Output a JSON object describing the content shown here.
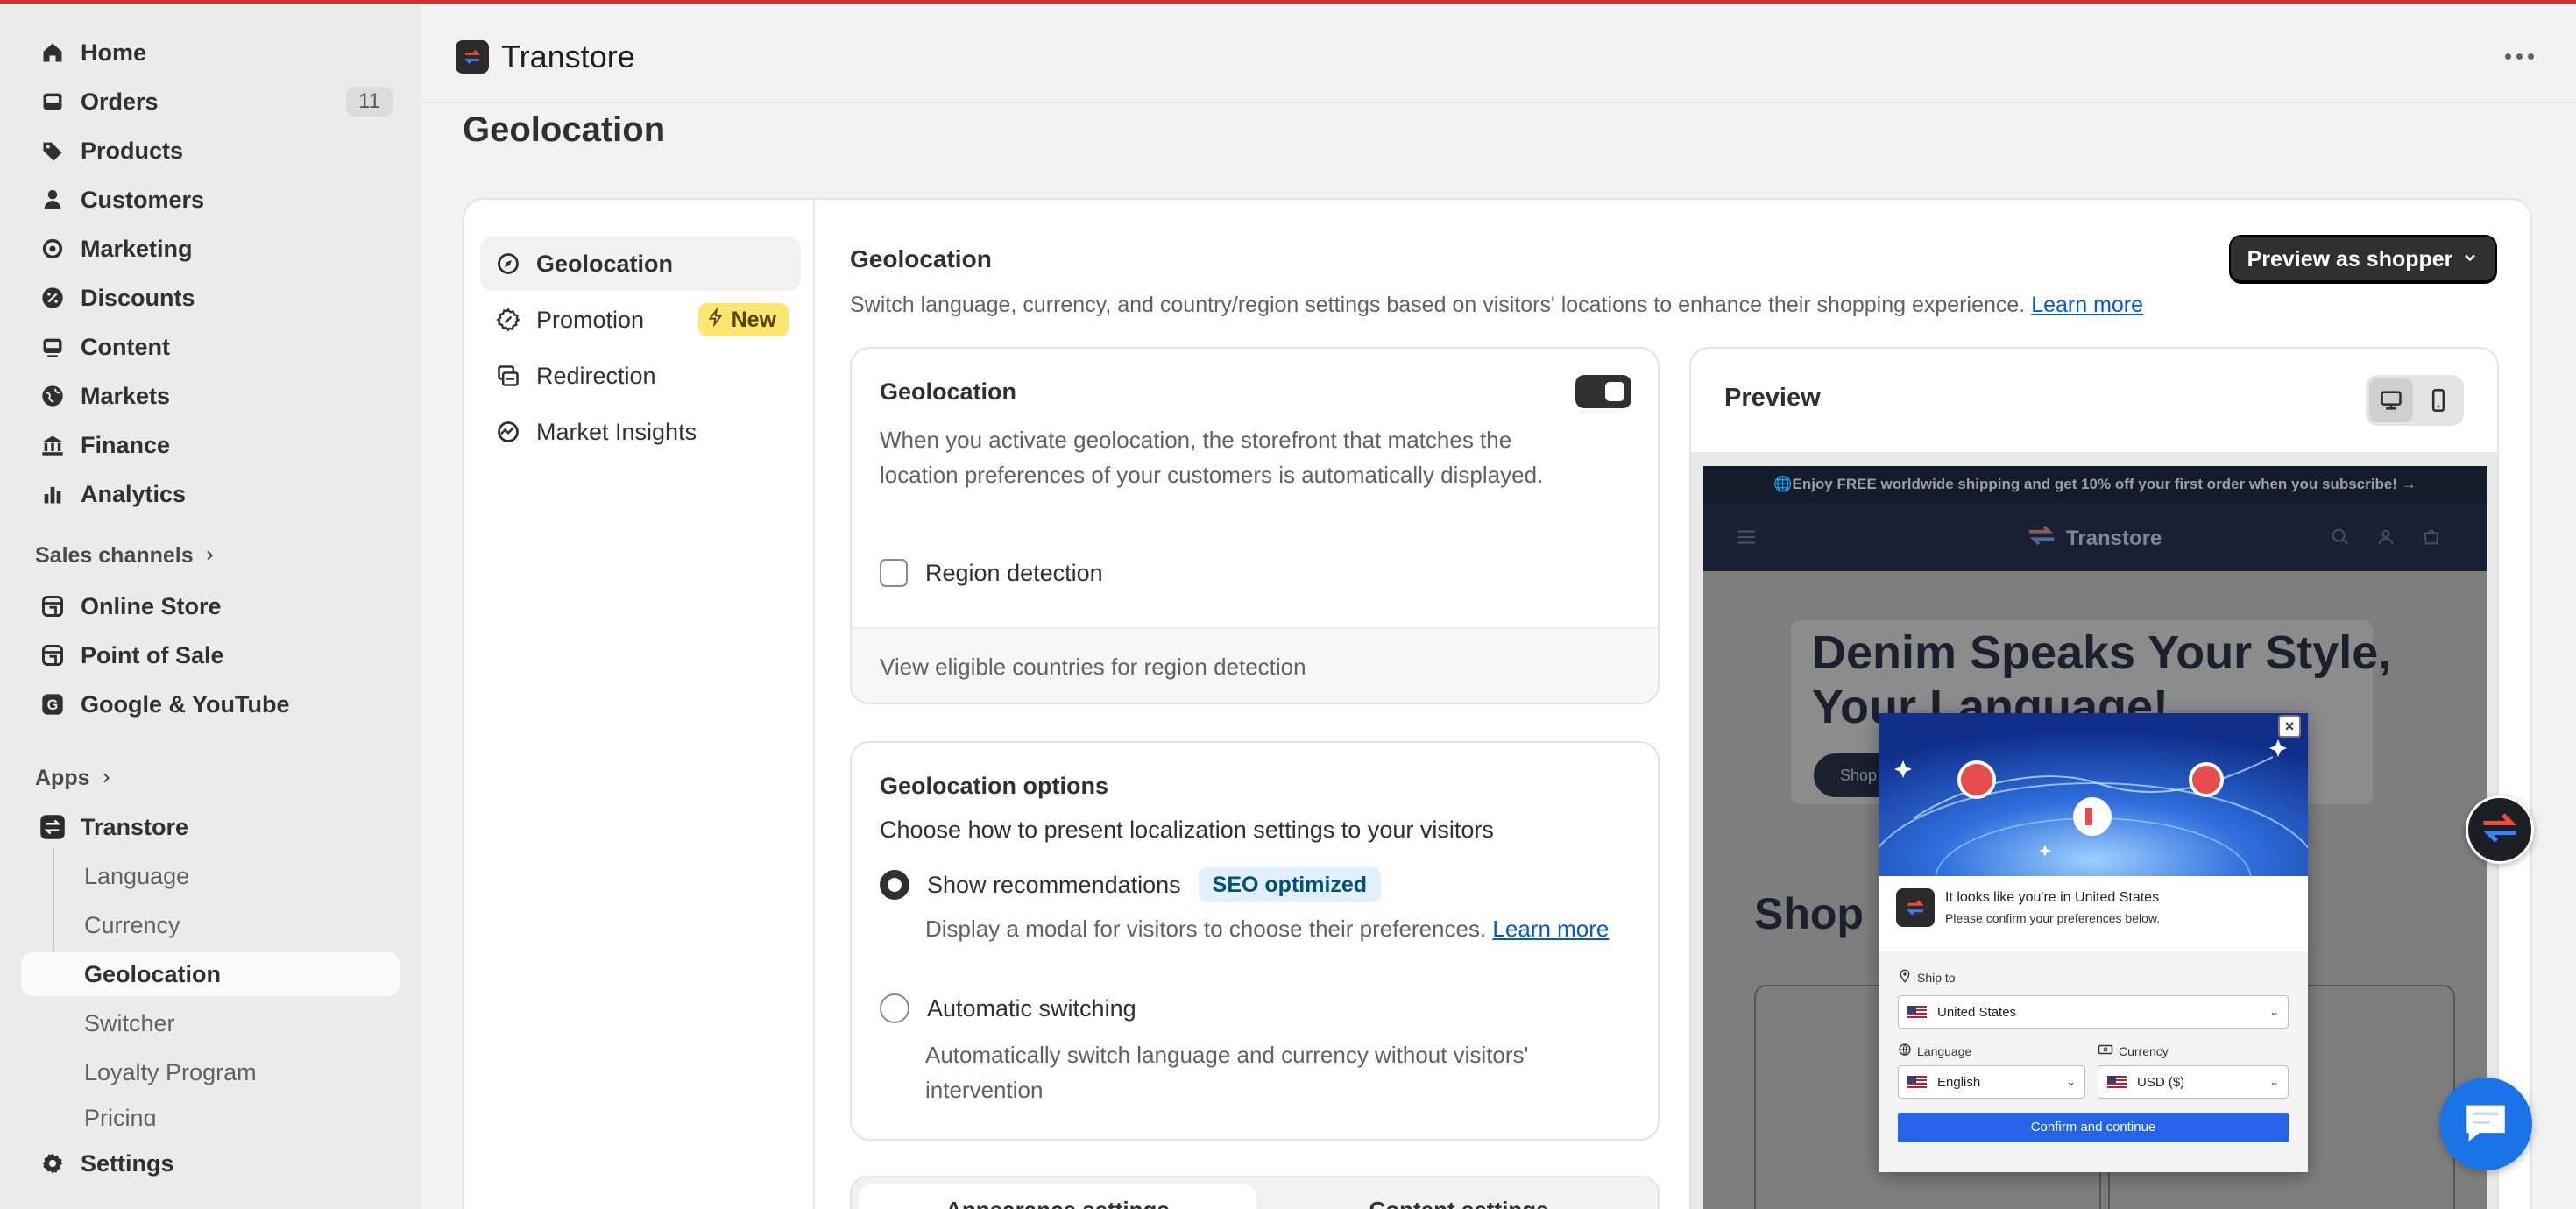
{
  "sidebar": {
    "items": [
      {
        "label": "Home",
        "icon": "home-icon"
      },
      {
        "label": "Orders",
        "icon": "orders-icon",
        "badge": "11"
      },
      {
        "label": "Products",
        "icon": "tag-icon"
      },
      {
        "label": "Customers",
        "icon": "person-icon"
      },
      {
        "label": "Marketing",
        "icon": "target-icon"
      },
      {
        "label": "Discounts",
        "icon": "discount-icon"
      },
      {
        "label": "Content",
        "icon": "content-icon"
      },
      {
        "label": "Markets",
        "icon": "globe-icon"
      },
      {
        "label": "Finance",
        "icon": "bank-icon"
      },
      {
        "label": "Analytics",
        "icon": "bar-chart-icon"
      }
    ],
    "sales_channels_label": "Sales channels",
    "channels": [
      {
        "label": "Online Store",
        "icon": "store-icon"
      },
      {
        "label": "Point of Sale",
        "icon": "pos-icon"
      },
      {
        "label": "Google & YouTube",
        "icon": "google-icon"
      }
    ],
    "apps_label": "Apps",
    "app": {
      "label": "Transtore",
      "icon": "transtore-icon"
    },
    "app_subitems": [
      "Language",
      "Currency",
      "Geolocation",
      "Switcher",
      "Loyalty Program",
      "Pricing"
    ],
    "active_subitem": "Geolocation",
    "settings_label": "Settings"
  },
  "topbar": {
    "app_name": "Transtore"
  },
  "page": {
    "title": "Geolocation"
  },
  "left_nav": {
    "tabs": [
      {
        "label": "Geolocation",
        "icon": "compass-icon",
        "active": true
      },
      {
        "label": "Promotion",
        "icon": "discount-icon",
        "badge": "New"
      },
      {
        "label": "Redirection",
        "icon": "redirect-icon"
      },
      {
        "label": "Market Insights",
        "icon": "insights-icon"
      }
    ]
  },
  "section": {
    "title": "Geolocation",
    "description": "Switch language, currency, and country/region settings based on visitors' locations to enhance their shopping experience.",
    "learn_more": "Learn more",
    "preview_button": "Preview as shopper"
  },
  "geo_card": {
    "title": "Geolocation",
    "toggle_on": true,
    "description": "When you activate geolocation, the storefront that matches the location preferences of your customers is automatically displayed.",
    "checkbox_label": "Region detection",
    "footer_link": "View eligible countries for region detection"
  },
  "options_card": {
    "title": "Geolocation options",
    "subtitle": "Choose how to present localization settings to your visitors",
    "option1_label": "Show recommendations",
    "option1_badge": "SEO optimized",
    "option1_desc": "Display a modal for visitors to choose their preferences.",
    "option1_link": "Learn more",
    "option2_label": "Automatic switching",
    "option2_desc": "Automatically switch language and currency without visitors' intervention",
    "selected": "Show recommendations"
  },
  "settings_tabs": [
    "Appearance settings",
    "Content settings"
  ],
  "preview": {
    "title": "Preview",
    "device_selected": "desktop",
    "store": {
      "announcement": "🌐Enjoy FREE worldwide shipping and get 10% off your first order when you subscribe! →",
      "logo": "Transtore",
      "hero_title": "Denim Speaks Your Style, Your Language!",
      "hero_button": "Shop",
      "shop_title": "Shop N"
    },
    "modal": {
      "line1": "It looks like you're in United States",
      "line2": "Please confirm your preferences below.",
      "ship_to_label": "Ship to",
      "ship_to_value": "United States",
      "language_label": "Language",
      "language_value": "English",
      "currency_label": "Currency",
      "currency_value": "USD ($)",
      "confirm_button": "Confirm and continue"
    }
  },
  "colors": {
    "accent_dark": "#303030",
    "link": "#005bd3",
    "new_badge": "#ffe46e",
    "seo_badge": "#e0f0ff",
    "modal_button": "#2563eb",
    "chat_button": "#1a73e8"
  }
}
